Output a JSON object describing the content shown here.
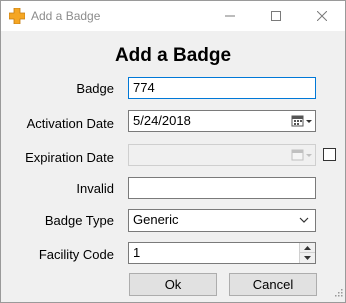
{
  "window": {
    "title": "Add a Badge",
    "icon": "plus-cross-icon",
    "accent": "#f5a623"
  },
  "form": {
    "heading": "Add a Badge",
    "badge": {
      "label": "Badge",
      "value": "774"
    },
    "activation_date": {
      "label": "Activation Date",
      "value": "5/24/2018"
    },
    "expiration_date": {
      "label": "Expiration Date",
      "value": "",
      "checked": false
    },
    "invalid": {
      "label": "Invalid",
      "value": ""
    },
    "badge_type": {
      "label": "Badge Type",
      "value": "Generic"
    },
    "facility_code": {
      "label": "Facility Code",
      "value": "1"
    }
  },
  "buttons": {
    "ok": "Ok",
    "cancel": "Cancel"
  }
}
